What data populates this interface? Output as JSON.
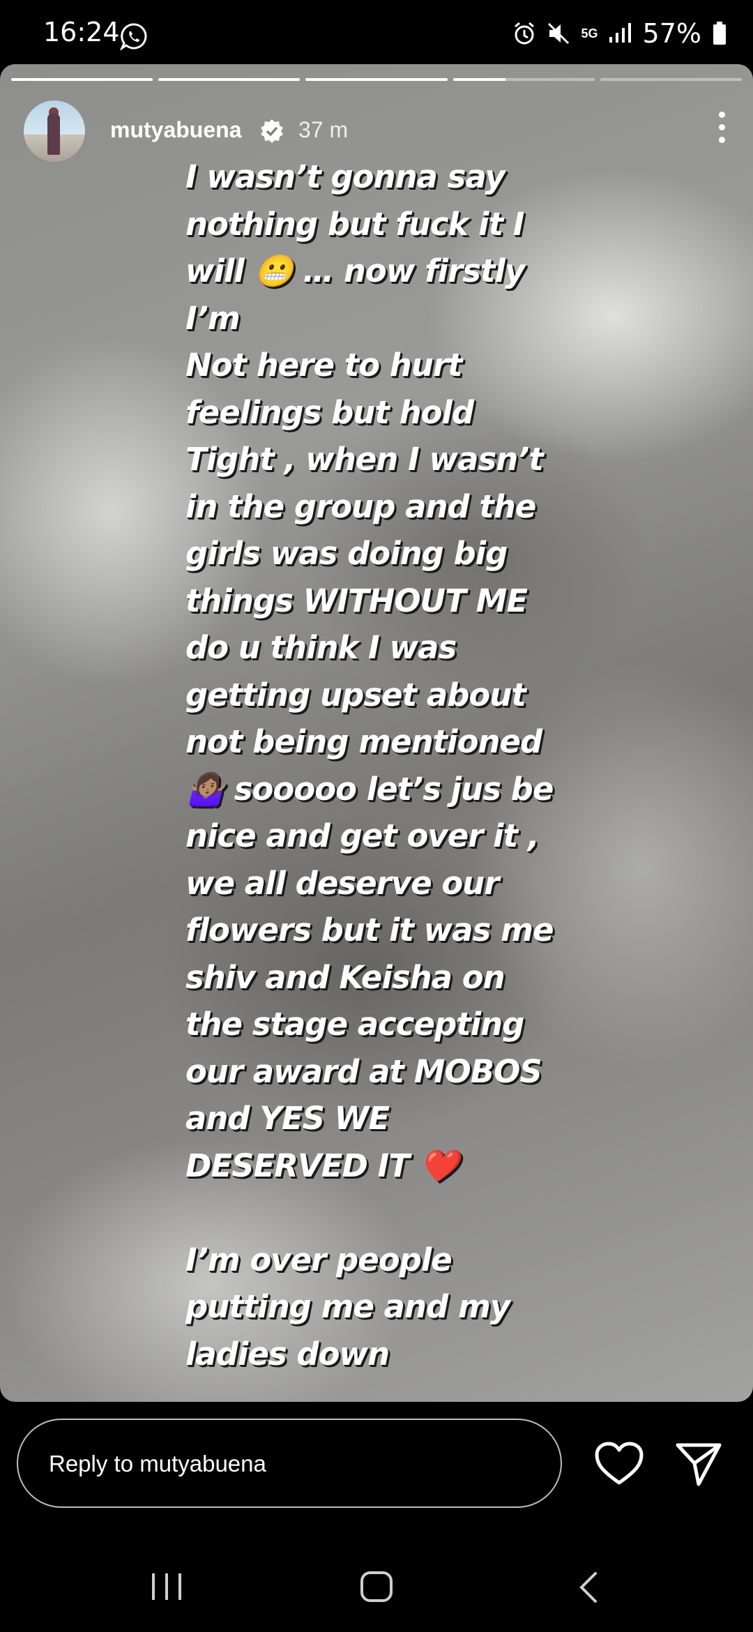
{
  "status_bar": {
    "time": "16:24",
    "network": "5G",
    "battery": "57%"
  },
  "story": {
    "progress": [
      1,
      1,
      1,
      0.37,
      0
    ],
    "username": "mutyabuena",
    "time_ago": "37 m",
    "caption": "I wasn’t gonna say\nnothing but fuck it I\nwill 😬 … now firstly\nI’m\nNot here to hurt\nfeelings but hold\nTight , when I wasn’t\nin the group and the\ngirls was doing big\nthings WITHOUT ME\ndo u think I was\ngetting upset about\nnot being mentioned\n🤷🏽‍♀️ sooooo let’s jus be\nnice and get over it ,\nwe all deserve our\nflowers but it was me\nshiv and Keisha on\nthe stage accepting\nour award at MOBOS\nand YES WE\nDESERVED IT ❤️\n\nI’m over people\nputting me and my\nladies down"
  },
  "reply": {
    "placeholder": "Reply to mutyabuena"
  },
  "icons": [
    "whatsapp-icon",
    "alarm-icon",
    "mute-icon",
    "signal-icon",
    "battery-icon",
    "verified-icon",
    "more-icon",
    "heart-icon",
    "send-icon",
    "recents-icon",
    "home-icon",
    "back-icon"
  ]
}
